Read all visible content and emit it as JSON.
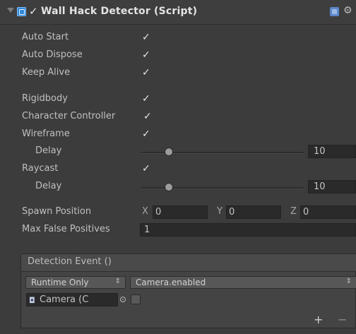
{
  "header": {
    "title": "Wall Hack Detector (Script)",
    "enabled": true
  },
  "fields": {
    "auto_start": "Auto Start",
    "auto_dispose": "Auto Dispose",
    "keep_alive": "Keep Alive",
    "rigidbody": "Rigidbody",
    "character_controller": "Character Controller",
    "wireframe": "Wireframe",
    "wireframe_delay": "Delay",
    "raycast": "Raycast",
    "raycast_delay": "Delay",
    "spawn_position": "Spawn Position",
    "max_false_positives": "Max False Positives"
  },
  "values": {
    "wireframe_delay": "10",
    "wireframe_delay_fraction": 0.17,
    "raycast_delay": "10",
    "raycast_delay_fraction": 0.17,
    "spawn_x_label": "X",
    "spawn_x": "0",
    "spawn_y_label": "Y",
    "spawn_y": "0",
    "spawn_z_label": "Z",
    "spawn_z": "0",
    "max_false_positives": "1"
  },
  "event": {
    "title": "Detection Event ()",
    "runtime_option": "Runtime Only",
    "function": "Camera.enabled",
    "object": "Camera (C",
    "plus": "+",
    "minus": "−"
  },
  "colors": {
    "background": "#3c3c3c",
    "field": "#2a2a2a",
    "text": "#c2c2c2"
  }
}
